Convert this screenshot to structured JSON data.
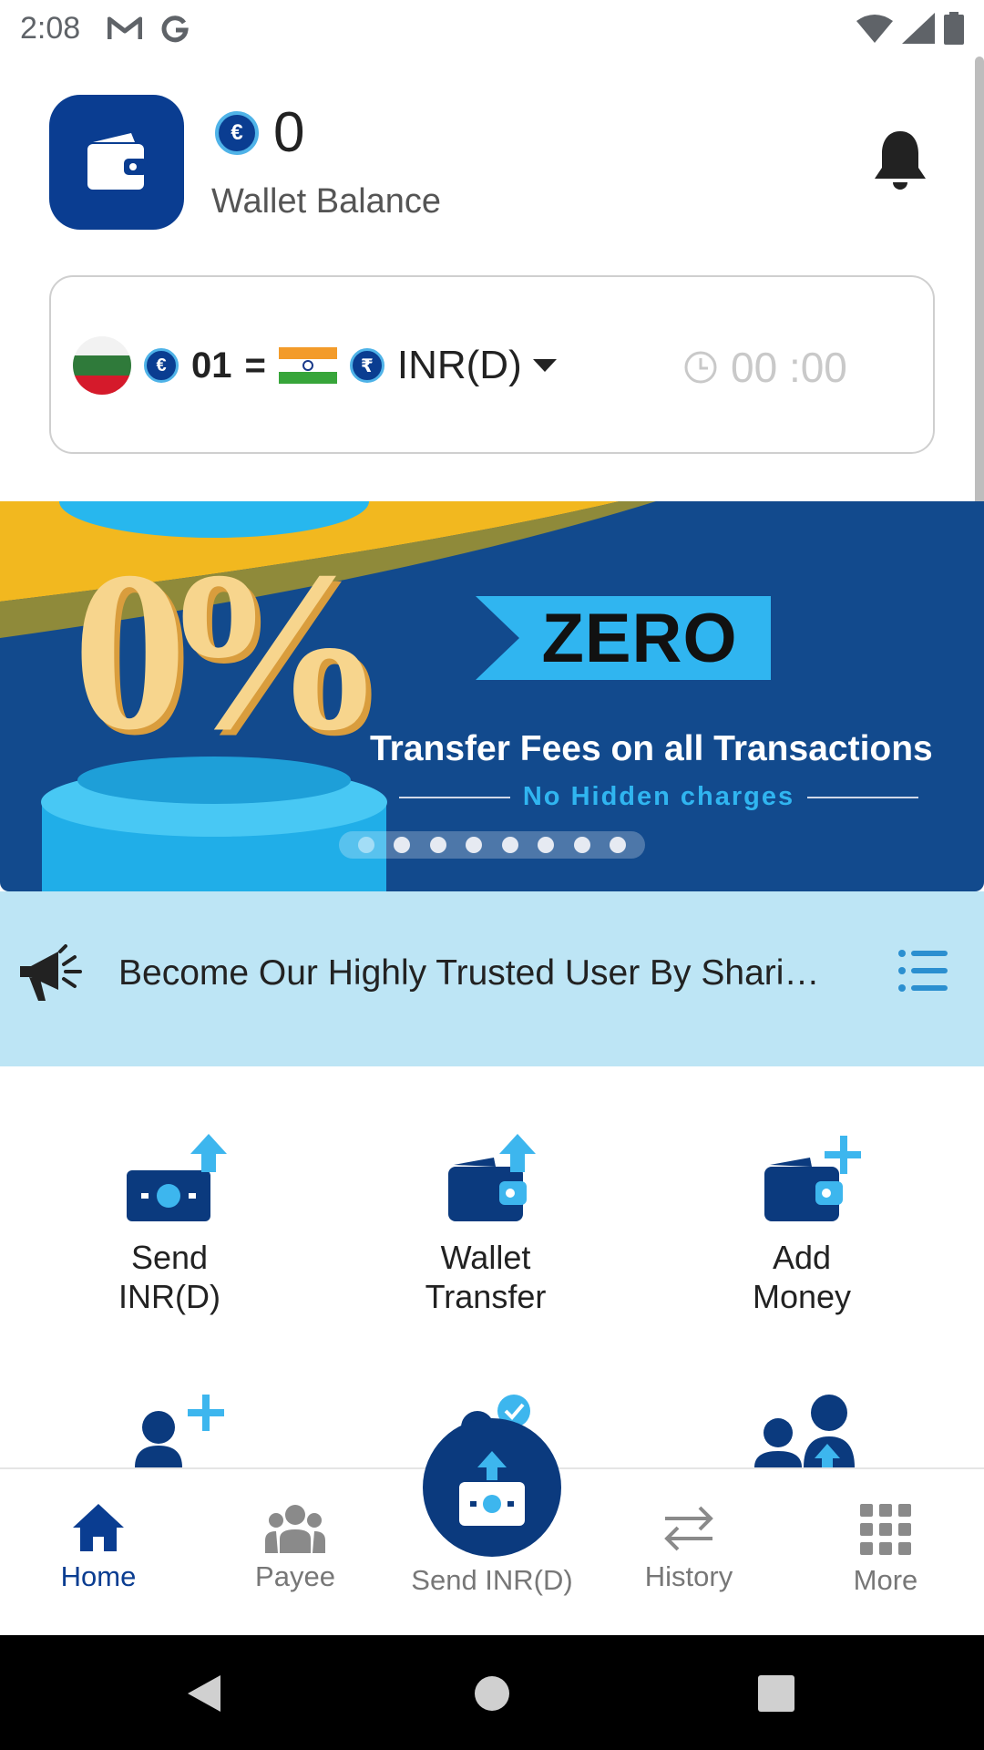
{
  "status_bar": {
    "time": "2:08"
  },
  "header": {
    "balance": "0",
    "balance_currency_symbol": "€",
    "balance_label": "Wallet Balance"
  },
  "rate_card": {
    "from_symbol": "€",
    "from_amount": "01",
    "equals": "=",
    "to_symbol": "₹",
    "to_currency": "INR(D)",
    "timer": "00 :00"
  },
  "banner": {
    "big_text": "0%",
    "tag": "ZERO",
    "line1": "Transfer Fees on all Transactions",
    "line2": "No Hidden charges",
    "slide_count": 8,
    "active_slide": 1
  },
  "announcement": {
    "text": "Become Our Highly Trusted User By Sharing Your Documents"
  },
  "actions": [
    {
      "line1": "Send",
      "line2": "INR(D)"
    },
    {
      "line1": "Wallet",
      "line2": "Transfer"
    },
    {
      "line1": "Add",
      "line2": "Money"
    }
  ],
  "bottom_nav": {
    "items": [
      {
        "label": "Home",
        "active": true
      },
      {
        "label": "Payee",
        "active": false
      },
      {
        "label": "Send INR(D)",
        "active": false
      },
      {
        "label": "History",
        "active": false
      },
      {
        "label": "More",
        "active": false
      }
    ]
  },
  "colors": {
    "primary": "#0a3d91",
    "accent": "#30b5f0",
    "banner_bg": "#124a8d",
    "announce_bg": "#bde5f5"
  }
}
